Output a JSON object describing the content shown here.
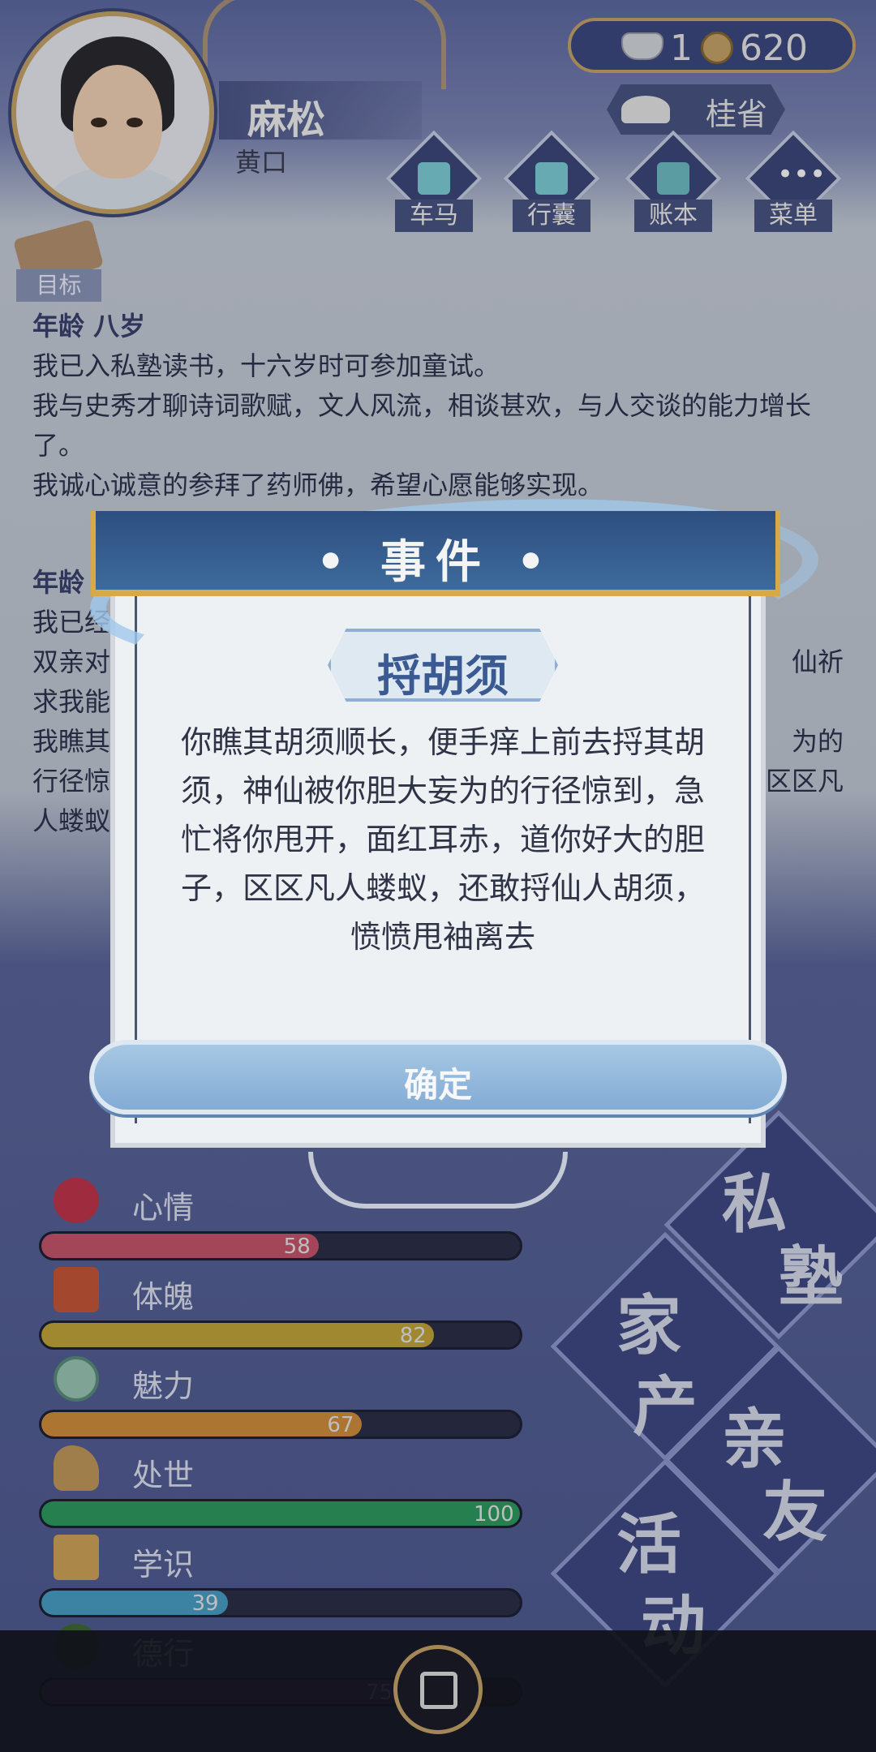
{
  "player": {
    "name": "麻松",
    "subtitle": "黄口"
  },
  "currency": {
    "silver": "1",
    "coins": "620"
  },
  "rank": {
    "label": "桂省"
  },
  "menu": [
    {
      "label": "车马",
      "icon": "carriage-icon"
    },
    {
      "label": "行囊",
      "icon": "bag-icon"
    },
    {
      "label": "账本",
      "icon": "ledger-icon"
    },
    {
      "label": "菜单",
      "icon": "more-icon"
    }
  ],
  "goal": {
    "label": "目标"
  },
  "log": {
    "age_line": "年龄 八岁",
    "lines": [
      "我已入私塾读书，十六岁时可参加童试。",
      "我与史秀才聊诗词歌赋，文人风流，相谈甚欢，与人交谈的能力增长了。",
      "我诚心诚意的参拜了药师佛，希望心愿能够实现。"
    ],
    "partial": {
      "age": "年龄",
      "l1": "我已经",
      "l2a": "双亲对",
      "l2b": "仙祈",
      "l3": "求我能",
      "l4a": "我瞧其",
      "l4b": "为的",
      "l5a": "行径惊",
      "l5b": "区区凡",
      "l6": "人蝼蚁"
    }
  },
  "stats": [
    {
      "label": "心情",
      "value": 58,
      "max": 100,
      "color": "#c9566d",
      "icon": "flower-icon"
    },
    {
      "label": "体魄",
      "value": 82,
      "max": 100,
      "color": "#c2a63a",
      "icon": "totem-icon"
    },
    {
      "label": "魅力",
      "value": 67,
      "max": 100,
      "color": "#d28f3d",
      "icon": "mirror-icon"
    },
    {
      "label": "处世",
      "value": 100,
      "max": 100,
      "color": "#2f9c61",
      "icon": "shoe-icon"
    },
    {
      "label": "学识",
      "value": 39,
      "max": 100,
      "color": "#4a9fc7",
      "icon": "brush-icon"
    },
    {
      "label": "德行",
      "value": 75,
      "max": 100,
      "color": "#7a3fa8",
      "icon": "coin-icon"
    }
  ],
  "actions": {
    "private_school": [
      "私",
      "塾"
    ],
    "family_property": [
      "家",
      "产"
    ],
    "relatives": [
      "亲",
      "友"
    ],
    "activities": [
      "活",
      "动"
    ]
  },
  "dialog": {
    "title": "• 事件 •",
    "event_name": "捋胡须",
    "text": "你瞧其胡须顺长，便手痒上前去捋其胡须，神仙被你胆大妄为的行径惊到，急忙将你甩开，面红耳赤，道你好大的胆子，区区凡人蝼蚁，还敢捋仙人胡须，愤愤甩袖离去",
    "confirm": "确定"
  }
}
